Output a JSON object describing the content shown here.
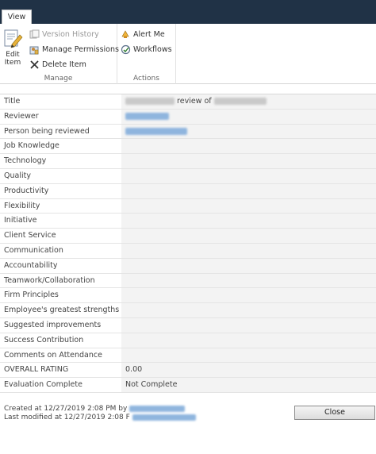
{
  "tabs": {
    "view": "View"
  },
  "ribbon": {
    "manage": {
      "label": "Manage",
      "edit_item_line1": "Edit",
      "edit_item_line2": "Item",
      "version_history": "Version History",
      "manage_permissions": "Manage Permissions",
      "delete_item": "Delete Item"
    },
    "actions": {
      "label": "Actions",
      "alert_me": "Alert Me",
      "workflows": "Workflows"
    }
  },
  "form": {
    "title_label": "Title",
    "title_suffix": "review of",
    "rows": [
      {
        "label": "Reviewer"
      },
      {
        "label": "Person being reviewed"
      },
      {
        "label": "Job Knowledge"
      },
      {
        "label": "Technology"
      },
      {
        "label": "Quality"
      },
      {
        "label": "Productivity"
      },
      {
        "label": "Flexibility"
      },
      {
        "label": "Initiative"
      },
      {
        "label": "Client Service"
      },
      {
        "label": "Communication"
      },
      {
        "label": "Accountability"
      },
      {
        "label": "Teamwork/Collaboration"
      },
      {
        "label": "Firm Principles"
      },
      {
        "label": "Employee's greatest strengths"
      },
      {
        "label": "Suggested improvements"
      },
      {
        "label": "Success Contribution"
      },
      {
        "label": "Comments on Attendance"
      },
      {
        "label": "OVERALL RATING",
        "value": "0.00"
      },
      {
        "label": "Evaluation Complete",
        "value": "Not Complete"
      }
    ]
  },
  "footer": {
    "created": "Created at 12/27/2019 2:08 PM by",
    "modified": "Last modified at 12/27/2019 2:08 F"
  },
  "close_label": "Close"
}
